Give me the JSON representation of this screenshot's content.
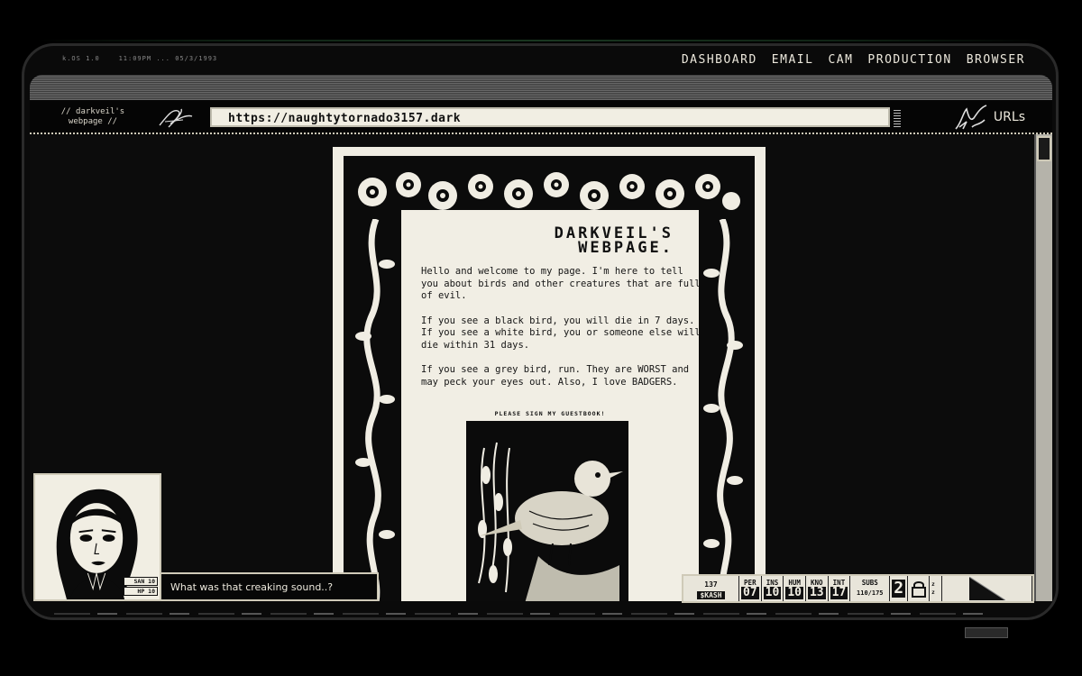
{
  "system": {
    "os_label": "k.OS 1.0",
    "time": "11:09PM",
    "separator": "...",
    "date": "05/3/1993"
  },
  "topnav": {
    "items": [
      "DASHBOARD",
      "EMAIL",
      "CAM",
      "PRODUCTION",
      "BROWSER"
    ]
  },
  "browser": {
    "site_name": "// darkveil's webpage //",
    "url": "https://naughtytornado3157.dark",
    "urls_label": "URLs"
  },
  "webpage": {
    "title_line1": "DARKVEIL'S",
    "title_line2": "WEBPAGE.",
    "paragraph1": "Hello and welcome to my page. I'm here to tell you about birds and other creatures that are full of evil.",
    "paragraph2": "If you see a black bird, you will die in 7 days. If you see a white bird, you or someone else will die within 31 days.",
    "paragraph3": "If you see a grey bird, run. They are WORST and may peck your eyes out. Also, I love BADGERS.",
    "guestbook_link": "PLEASE SIGN MY GUESTBOOK!"
  },
  "character": {
    "san_label": "SAN 10",
    "hp_label": "HP 10",
    "dialogue": "What was that creaking sound..?"
  },
  "stats": {
    "money_value": "137",
    "money_label": "$KASH",
    "per_label": "PER",
    "per_value": "07",
    "ins_label": "INS",
    "ins_value": "10",
    "hum_label": "HUM",
    "hum_value": "10",
    "kno_label": "KNO",
    "kno_value": "13",
    "int_label": "INT",
    "int_value": "17",
    "subs_label": "SUBS",
    "subs_value": "110/175",
    "level_value": "2",
    "sleep_icon": "z z"
  },
  "colors": {
    "paper": "#f0ede3",
    "ink": "#0b0b0b",
    "chrome": "#cfcab8"
  }
}
